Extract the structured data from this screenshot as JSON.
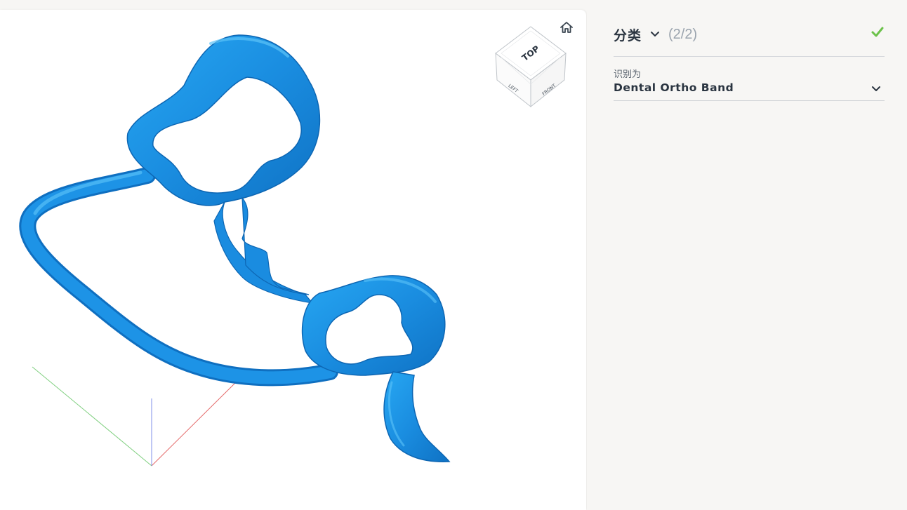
{
  "viewport": {
    "nav_cube": {
      "top_label": "TOP",
      "left_label": "LEFT",
      "front_label": "FRONT"
    },
    "home_icon": "home-icon",
    "model_color": "#1c8fe0",
    "axes": {
      "x_color": "#e05a5a",
      "y_color": "#6fc46f",
      "z_color": "#6f7fe0"
    }
  },
  "panel": {
    "title": "分类",
    "count": "(2/2)",
    "status_icon": "check-icon",
    "status_color": "#6cc24a",
    "field": {
      "label": "识别为",
      "value": "Dental Ortho Band"
    }
  }
}
